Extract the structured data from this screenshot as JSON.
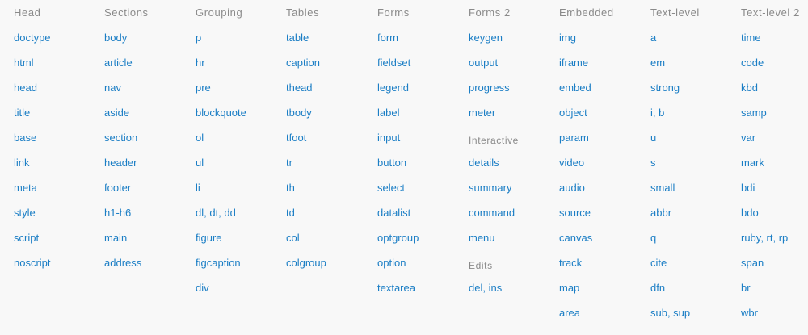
{
  "columns": [
    {
      "heading": "Head",
      "groups": [
        {
          "links": [
            "doctype",
            "html",
            "head",
            "title",
            "base",
            "link",
            "meta",
            "style",
            "script",
            "noscript"
          ]
        }
      ]
    },
    {
      "heading": "Sections",
      "groups": [
        {
          "links": [
            "body",
            "article",
            "nav",
            "aside",
            "section",
            "header",
            "footer",
            "h1-h6",
            "main",
            "address"
          ]
        }
      ]
    },
    {
      "heading": "Grouping",
      "groups": [
        {
          "links": [
            "p",
            "hr",
            "pre",
            "blockquote",
            "ol",
            "ul",
            "li",
            "dl, dt, dd",
            "figure",
            "figcaption",
            "div"
          ]
        }
      ]
    },
    {
      "heading": "Tables",
      "groups": [
        {
          "links": [
            "table",
            "caption",
            "thead",
            "tbody",
            "tfoot",
            "tr",
            "th",
            "td",
            "col",
            "colgroup"
          ]
        }
      ]
    },
    {
      "heading": "Forms",
      "groups": [
        {
          "links": [
            "form",
            "fieldset",
            "legend",
            "label",
            "input",
            "button",
            "select",
            "datalist",
            "optgroup",
            "option",
            "textarea"
          ]
        }
      ]
    },
    {
      "heading": "Forms 2",
      "groups": [
        {
          "links": [
            "keygen",
            "output",
            "progress",
            "meter"
          ]
        },
        {
          "subheading": "Interactive",
          "links": [
            "details",
            "summary",
            "command",
            "menu"
          ]
        },
        {
          "subheading": "Edits",
          "links": [
            "del, ins"
          ]
        }
      ]
    },
    {
      "heading": "Embedded",
      "groups": [
        {
          "links": [
            "img",
            "iframe",
            "embed",
            "object",
            "param",
            "video",
            "audio",
            "source",
            "canvas",
            "track",
            "map",
            "area"
          ]
        }
      ]
    },
    {
      "heading": "Text-level",
      "groups": [
        {
          "links": [
            "a",
            "em",
            "strong",
            "i, b",
            "u",
            "s",
            "small",
            "abbr",
            "q",
            "cite",
            "dfn",
            "sub, sup"
          ]
        }
      ]
    },
    {
      "heading": "Text-level 2",
      "groups": [
        {
          "links": [
            "time",
            "code",
            "kbd",
            "samp",
            "var",
            "mark",
            "bdi",
            "bdo",
            "ruby, rt, rp",
            "span",
            "br",
            "wbr"
          ]
        }
      ]
    }
  ]
}
